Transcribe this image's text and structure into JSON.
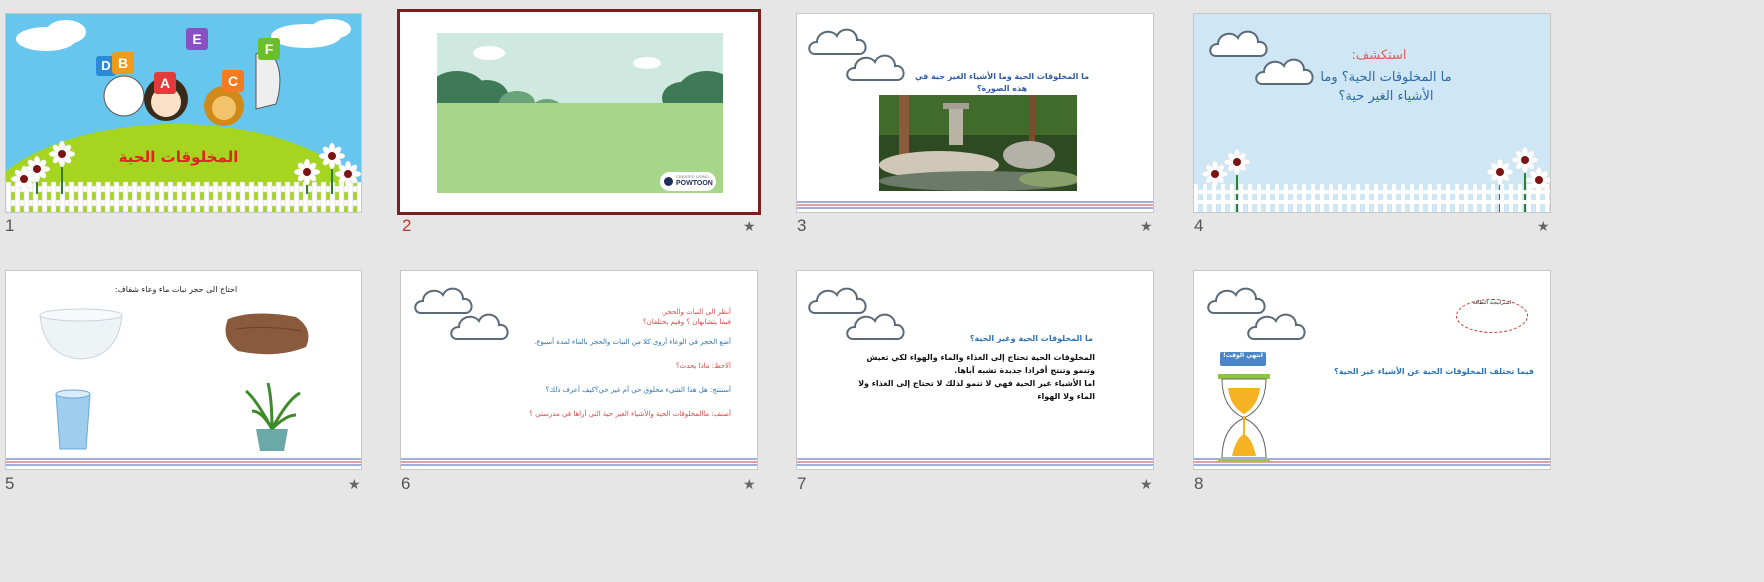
{
  "slides": [
    {
      "number": "1",
      "title": "المخلوقات الحية",
      "letters": [
        "D",
        "B",
        "A",
        "E",
        "C",
        "F"
      ],
      "starred": false,
      "selected": false
    },
    {
      "number": "2",
      "logo_small": "CREATED USING",
      "logo_name": "POWTOON",
      "starred": true,
      "selected": true
    },
    {
      "number": "3",
      "question": "ما المخلوقات الحية وما الأشياء الغير حية في هذه الصورة؟",
      "starred": true,
      "selected": false
    },
    {
      "number": "4",
      "heading": "استكشف:",
      "question": "ما المخلوقات الحية؟ وما الأشياء الغير حية؟",
      "starred": true,
      "selected": false
    },
    {
      "number": "5",
      "caption": "احتاج الى حجر نبات ماء وعاء شفاف:",
      "starred": true,
      "selected": false
    },
    {
      "number": "6",
      "lines": [
        "أنظر الى النبات والحجر.",
        "فيما يتشابهان ؟ وفيم يختلفان؟",
        "أضع الحجر في الوعاء أروى كلا من النبات والحجر بالماء لمدة أسبوع.",
        "ألاحظ: ماذا يحدث؟",
        "أستنتج: هل هذا الشيء مخلوق حي أم غير حي؟كيف أعرف ذلك؟",
        "أصنف: ماالمخلوقات الحية والأشياء الغير حية التي أراها في مدرستي ؟"
      ],
      "starred": true,
      "selected": false
    },
    {
      "number": "7",
      "heading": "ما المخلوقات الحية وغير الحية؟",
      "body": [
        "المخلوقات الحية تحتاج إلى الغذاء والماء والهواء لكي تعيش وتنمو وتنتج أفرادا جديدة تشبه آباها.",
        "اما الأشياء غير الحية فهي لا تنمو لذلك لا تحتاج إلى الغذاء ولا الماء ولا الهواء"
      ],
      "starred": true,
      "selected": false
    },
    {
      "number": "8",
      "badge": "استراتيجية البطاقة",
      "button": "انتهي الوقت!",
      "question": "فيما تختلف المخلوقات الحية عن الأشياء غير الحية؟",
      "starred": false,
      "selected": false
    }
  ],
  "star_glyph": "★",
  "colors": {
    "selection": "#7a1e1e",
    "number": "#555555",
    "number_selected": "#c0392b",
    "blue_text": "#2e74b5",
    "red_text": "#e04848"
  }
}
